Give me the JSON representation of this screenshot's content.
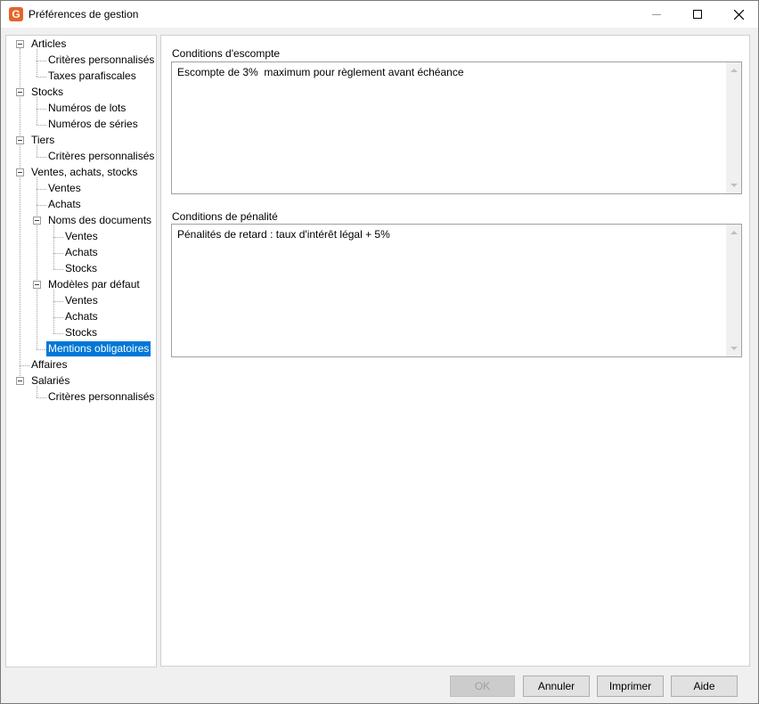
{
  "window": {
    "title": "Préférences de gestion",
    "app_icon_letter": "G"
  },
  "tree": {
    "nodes": [
      {
        "label": "Articles"
      },
      {
        "label": "Critères personnalisés"
      },
      {
        "label": "Taxes parafiscales"
      },
      {
        "label": "Stocks"
      },
      {
        "label": "Numéros de lots"
      },
      {
        "label": "Numéros de séries"
      },
      {
        "label": "Tiers"
      },
      {
        "label": "Critères personnalisés"
      },
      {
        "label": "Ventes, achats, stocks"
      },
      {
        "label": "Ventes"
      },
      {
        "label": "Achats"
      },
      {
        "label": "Noms des documents"
      },
      {
        "label": "Ventes"
      },
      {
        "label": "Achats"
      },
      {
        "label": "Stocks"
      },
      {
        "label": "Modèles par défaut"
      },
      {
        "label": "Ventes"
      },
      {
        "label": "Achats"
      },
      {
        "label": "Stocks"
      },
      {
        "label": "Mentions obligatoires",
        "selected": true
      },
      {
        "label": "Affaires"
      },
      {
        "label": "Salariés"
      },
      {
        "label": "Critères personnalisés"
      }
    ]
  },
  "main": {
    "escompte": {
      "label": "Conditions d'escompte",
      "value": "Escompte de 3%  maximum pour règlement avant échéance"
    },
    "penalite": {
      "label": "Conditions de pénalité",
      "value": "Pénalités de retard : taux d'intérêt légal + 5%"
    }
  },
  "buttons": {
    "ok": "OK",
    "annuler": "Annuler",
    "imprimer": "Imprimer",
    "aide": "Aide"
  },
  "colors": {
    "selection": "#0078d7",
    "brand": "#e8622a"
  }
}
